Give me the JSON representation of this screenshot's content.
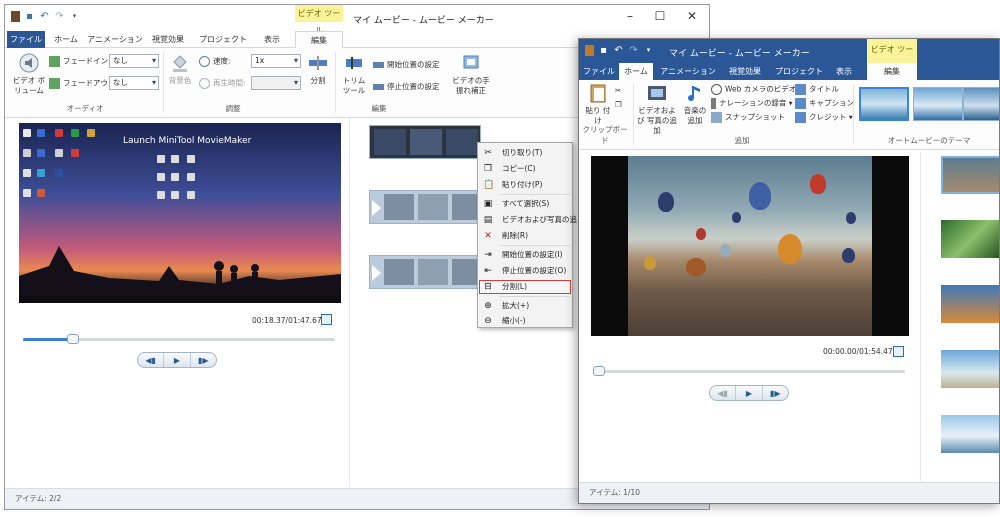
{
  "window_back": {
    "title": "マイ ムービー - ムービー メーカー",
    "context_tab": "ビデオ ツール",
    "tabs": [
      "ファイル",
      "ホーム",
      "アニメーション",
      "視覚効果",
      "プロジェクト",
      "表示",
      "編集"
    ],
    "ribbon": {
      "audio_group": "オーディオ",
      "video_volume": "ビデオ ボリューム",
      "fade_in_label": "フェードイン:",
      "fade_in_value": "なし",
      "fade_out_label": "フェードアウト:",
      "fade_out_value": "なし",
      "adjust_group": "調整",
      "background_color": "背景色",
      "speed_label": "速度:",
      "speed_value": "1x",
      "duration_label": "再生時間:",
      "split": "分割",
      "edit_group": "編集",
      "trim_tool": "トリム ツール",
      "set_start": "開始位置の設定",
      "set_end": "停止位置の設定",
      "stabilize": "ビデオの手振れ補正"
    },
    "preview": {
      "overlay_text": "Launch MiniTool MovieMaker",
      "timecode": "00:18.37/01:47.67",
      "progress": 0.16
    },
    "context_menu": {
      "items": [
        "切り取り(T)",
        "コピー(C)",
        "貼り付け(P)",
        "すべて選択(S)",
        "ビデオおよび写真の追",
        "削除(R)",
        "開始位置の設定(I)",
        "停止位置の設定(O)",
        "分割(L)",
        "拡大(+)",
        "縮小(-)"
      ],
      "highlighted": "分割(L)",
      "highlight_color": "#d23b3b"
    },
    "status": "アイテム: 2/2"
  },
  "window_front": {
    "title": "マイ ムービー - ムービー メーカー",
    "context_tab": "ビデオ ツール",
    "tabs": [
      "ファイル",
      "ホーム",
      "アニメーション",
      "視覚効果",
      "プロジェクト",
      "表示",
      "編集"
    ],
    "ribbon": {
      "paste": "貼り 付け",
      "clipboard_group": "クリップボード",
      "add_videos_photos": "ビデオおよび 写真の追加",
      "add_music": "音楽の 追加",
      "webcam_video": "Web カメラのビデオ",
      "record_narration": "ナレーションの録音",
      "snapshot": "スナップショット",
      "title": "タイトル",
      "caption": "キャプション",
      "credits": "クレジット",
      "add_group": "追加",
      "automovie_group": "オートムービーのテーマ"
    },
    "preview": {
      "timecode": "00:00.00/01:54.47",
      "progress": 0.0
    },
    "status": "アイテム: 1/10"
  },
  "colors": {
    "file_tab": "#2b5797",
    "context_tab_bg": "#fbf39a",
    "accent": "#3b7fd0"
  }
}
